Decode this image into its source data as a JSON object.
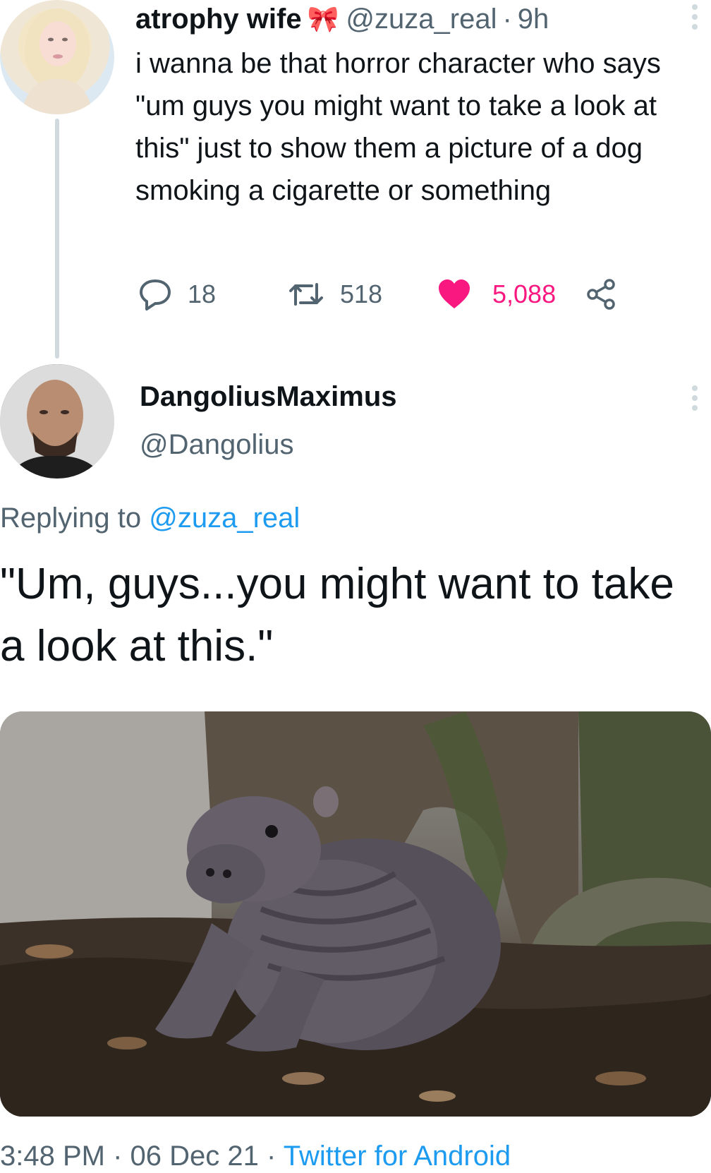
{
  "original_tweet": {
    "display_name": "atrophy wife",
    "name_emoji": "🎀",
    "handle": "@zuza_real",
    "separator": "·",
    "time": "9h",
    "text": "i wanna be that horror character who says \"um guys you might want to take a look at this\" just to show them a picture of a dog smoking a cigarette or something",
    "stats": {
      "replies": "18",
      "retweets": "518",
      "likes": "5,088"
    },
    "liked": true,
    "like_color": "#f91880"
  },
  "reply_tweet": {
    "display_name": "DangoliusMaximus",
    "handle": "@Dangolius",
    "replying_prefix": "Replying to",
    "replying_handle": "@zuza_real",
    "text": "\"Um, guys...you might want to take a look at this.\"",
    "media_subject": "baby pygmy hippo",
    "footer": {
      "time": "3:48 PM",
      "separator": "·",
      "date": "06 Dec 21",
      "source": "Twitter for Android"
    }
  },
  "colors": {
    "text_primary": "#0f1419",
    "text_secondary": "#536471",
    "link": "#1d9bf0",
    "divider": "#cfd9de"
  },
  "icons": [
    "more-options-icon",
    "reply-icon",
    "retweet-icon",
    "heart-icon",
    "share-icon",
    "ribbon-emoji"
  ]
}
